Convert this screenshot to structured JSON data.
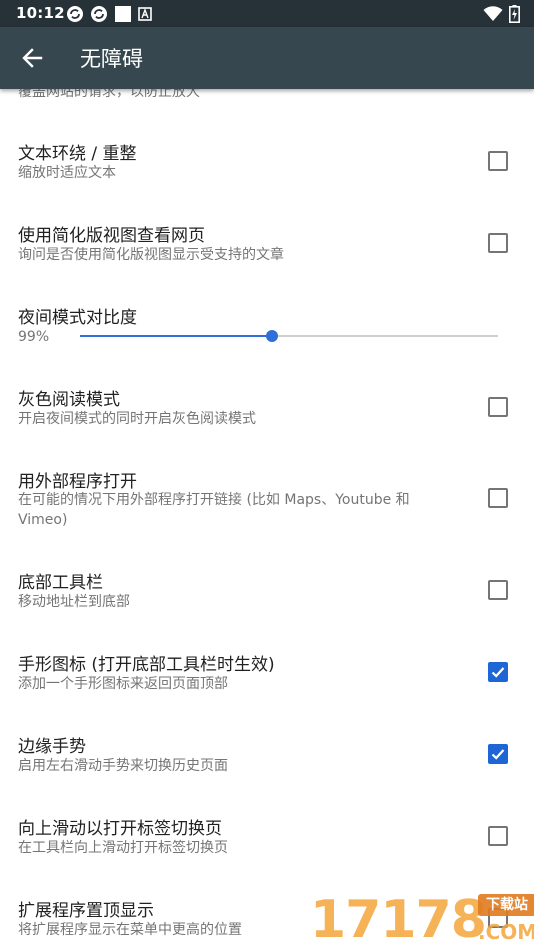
{
  "status": {
    "time": "10:12",
    "icons_left": [
      "sync-icon",
      "sync-icon",
      "square-icon",
      "a-notification-icon"
    ],
    "icons_right": [
      "wifi-icon",
      "battery-charging-icon"
    ]
  },
  "appbar": {
    "title": "无障碍",
    "back_icon": "arrow-left-icon"
  },
  "cut_summary": "覆盖网站的请求，以防止放大",
  "prefs": [
    {
      "title": "文本环绕 / 重整",
      "summary": "缩放时适应文本",
      "checked": false
    },
    {
      "title": "使用简化版视图查看网页",
      "summary": "询问是否使用简化版视图显示受支持的文章",
      "checked": false
    },
    {
      "title": "灰色阅读模式",
      "summary": "开启夜间模式的同时开启灰色阅读模式",
      "checked": false
    },
    {
      "title": "用外部程序打开",
      "summary": "在可能的情况下用外部程序打开链接 (比如 Maps、Youtube 和 Vimeo)",
      "checked": false
    },
    {
      "title": "底部工具栏",
      "summary": "移动地址栏到底部",
      "checked": false
    },
    {
      "title": "手形图标 (打开底部工具栏时生效)",
      "summary": "添加一个手形图标来返回页面顶部",
      "checked": true
    },
    {
      "title": "边缘手势",
      "summary": "启用左右滑动手势来切换历史页面",
      "checked": true
    },
    {
      "title": "向上滑动以打开标签切换页",
      "summary": "在工具栏向上滑动打开标签切换页",
      "checked": false
    },
    {
      "title": "扩展程序置顶显示",
      "summary": "将扩展程序显示在菜单中更高的位置",
      "checked": false
    }
  ],
  "slider": {
    "title": "夜间模式对比度",
    "value_label": "99%",
    "fraction": 0.46
  },
  "watermark": {
    "number": "17178",
    "badge": "下载站",
    "domain": ".COM"
  },
  "colors": {
    "statusbar": "#263238",
    "appbar": "#37474f",
    "accent": "#1e66d6"
  }
}
